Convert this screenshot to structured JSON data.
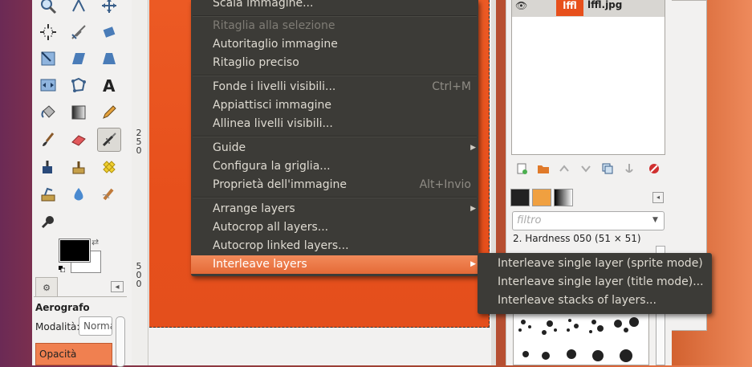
{
  "toolbox": {
    "tools": [
      "zoom-tool",
      "measure-tool",
      "move-tool",
      "align-tool",
      "crop-tool",
      "rotate-tool",
      "scale-tool",
      "shear-tool",
      "perspective-tool",
      "flip-tool",
      "cage-tool",
      "text-tool",
      "bucket-fill-tool",
      "blend-tool",
      "pencil-tool",
      "paintbrush-tool",
      "eraser-tool",
      "airbrush-tool",
      "ink-tool",
      "clone-tool",
      "heal-tool",
      "perspective-clone-tool",
      "blur-tool",
      "smudge-tool",
      "dodge-burn-tool"
    ],
    "fg_color": "#000000",
    "bg_color": "#ffffff",
    "tool_options": {
      "title": "Aerografo",
      "mode_label": "Modalità:",
      "mode_value": "Norma",
      "opacity_label": "Opacità"
    }
  },
  "ruler": {
    "label_top": [
      "2",
      "5",
      "0"
    ],
    "label_bottom": [
      "5",
      "0",
      "0"
    ]
  },
  "image_menu": {
    "items": [
      {
        "label": "Scala immagine...",
        "disabled": false
      },
      {
        "label": "Ritaglia alla selezione",
        "disabled": true
      },
      {
        "label": "Autoritaglio immagine",
        "disabled": false
      },
      {
        "label": "Ritaglio preciso",
        "disabled": false
      },
      {
        "label": "Fonde i livelli visibili...",
        "accel": "Ctrl+M",
        "disabled": false
      },
      {
        "label": "Appiattisci immagine",
        "disabled": false
      },
      {
        "label": "Allinea livelli visibili...",
        "disabled": false
      },
      {
        "label": "Guide",
        "submenu": true
      },
      {
        "label": "Configura la griglia...",
        "disabled": false
      },
      {
        "label": "Proprietà dell'immagine",
        "accel": "Alt+Invio",
        "disabled": false
      },
      {
        "label": "Arrange layers",
        "submenu": true
      },
      {
        "label": "Autocrop all layers...",
        "disabled": false
      },
      {
        "label": "Autocrop linked layers...",
        "disabled": false
      },
      {
        "label": "Interleave layers",
        "submenu": true,
        "highlighted": true
      }
    ]
  },
  "interleave_submenu": {
    "items": [
      "Interleave single layer (sprite mode)",
      "Interleave single layer (title mode)...",
      "Interleave stacks of layers..."
    ]
  },
  "layers": {
    "items": [
      {
        "name": "lffl.jpg",
        "thumb_text": "lffl"
      }
    ]
  },
  "brushes": {
    "filter_placeholder": "filtro",
    "selected_brush": "2. Hardness 050 (51 × 51)"
  },
  "colors": {
    "menu_bg": "#3c3b37",
    "menu_highlight": "#e9723f",
    "image_fill": "#e7501c"
  }
}
